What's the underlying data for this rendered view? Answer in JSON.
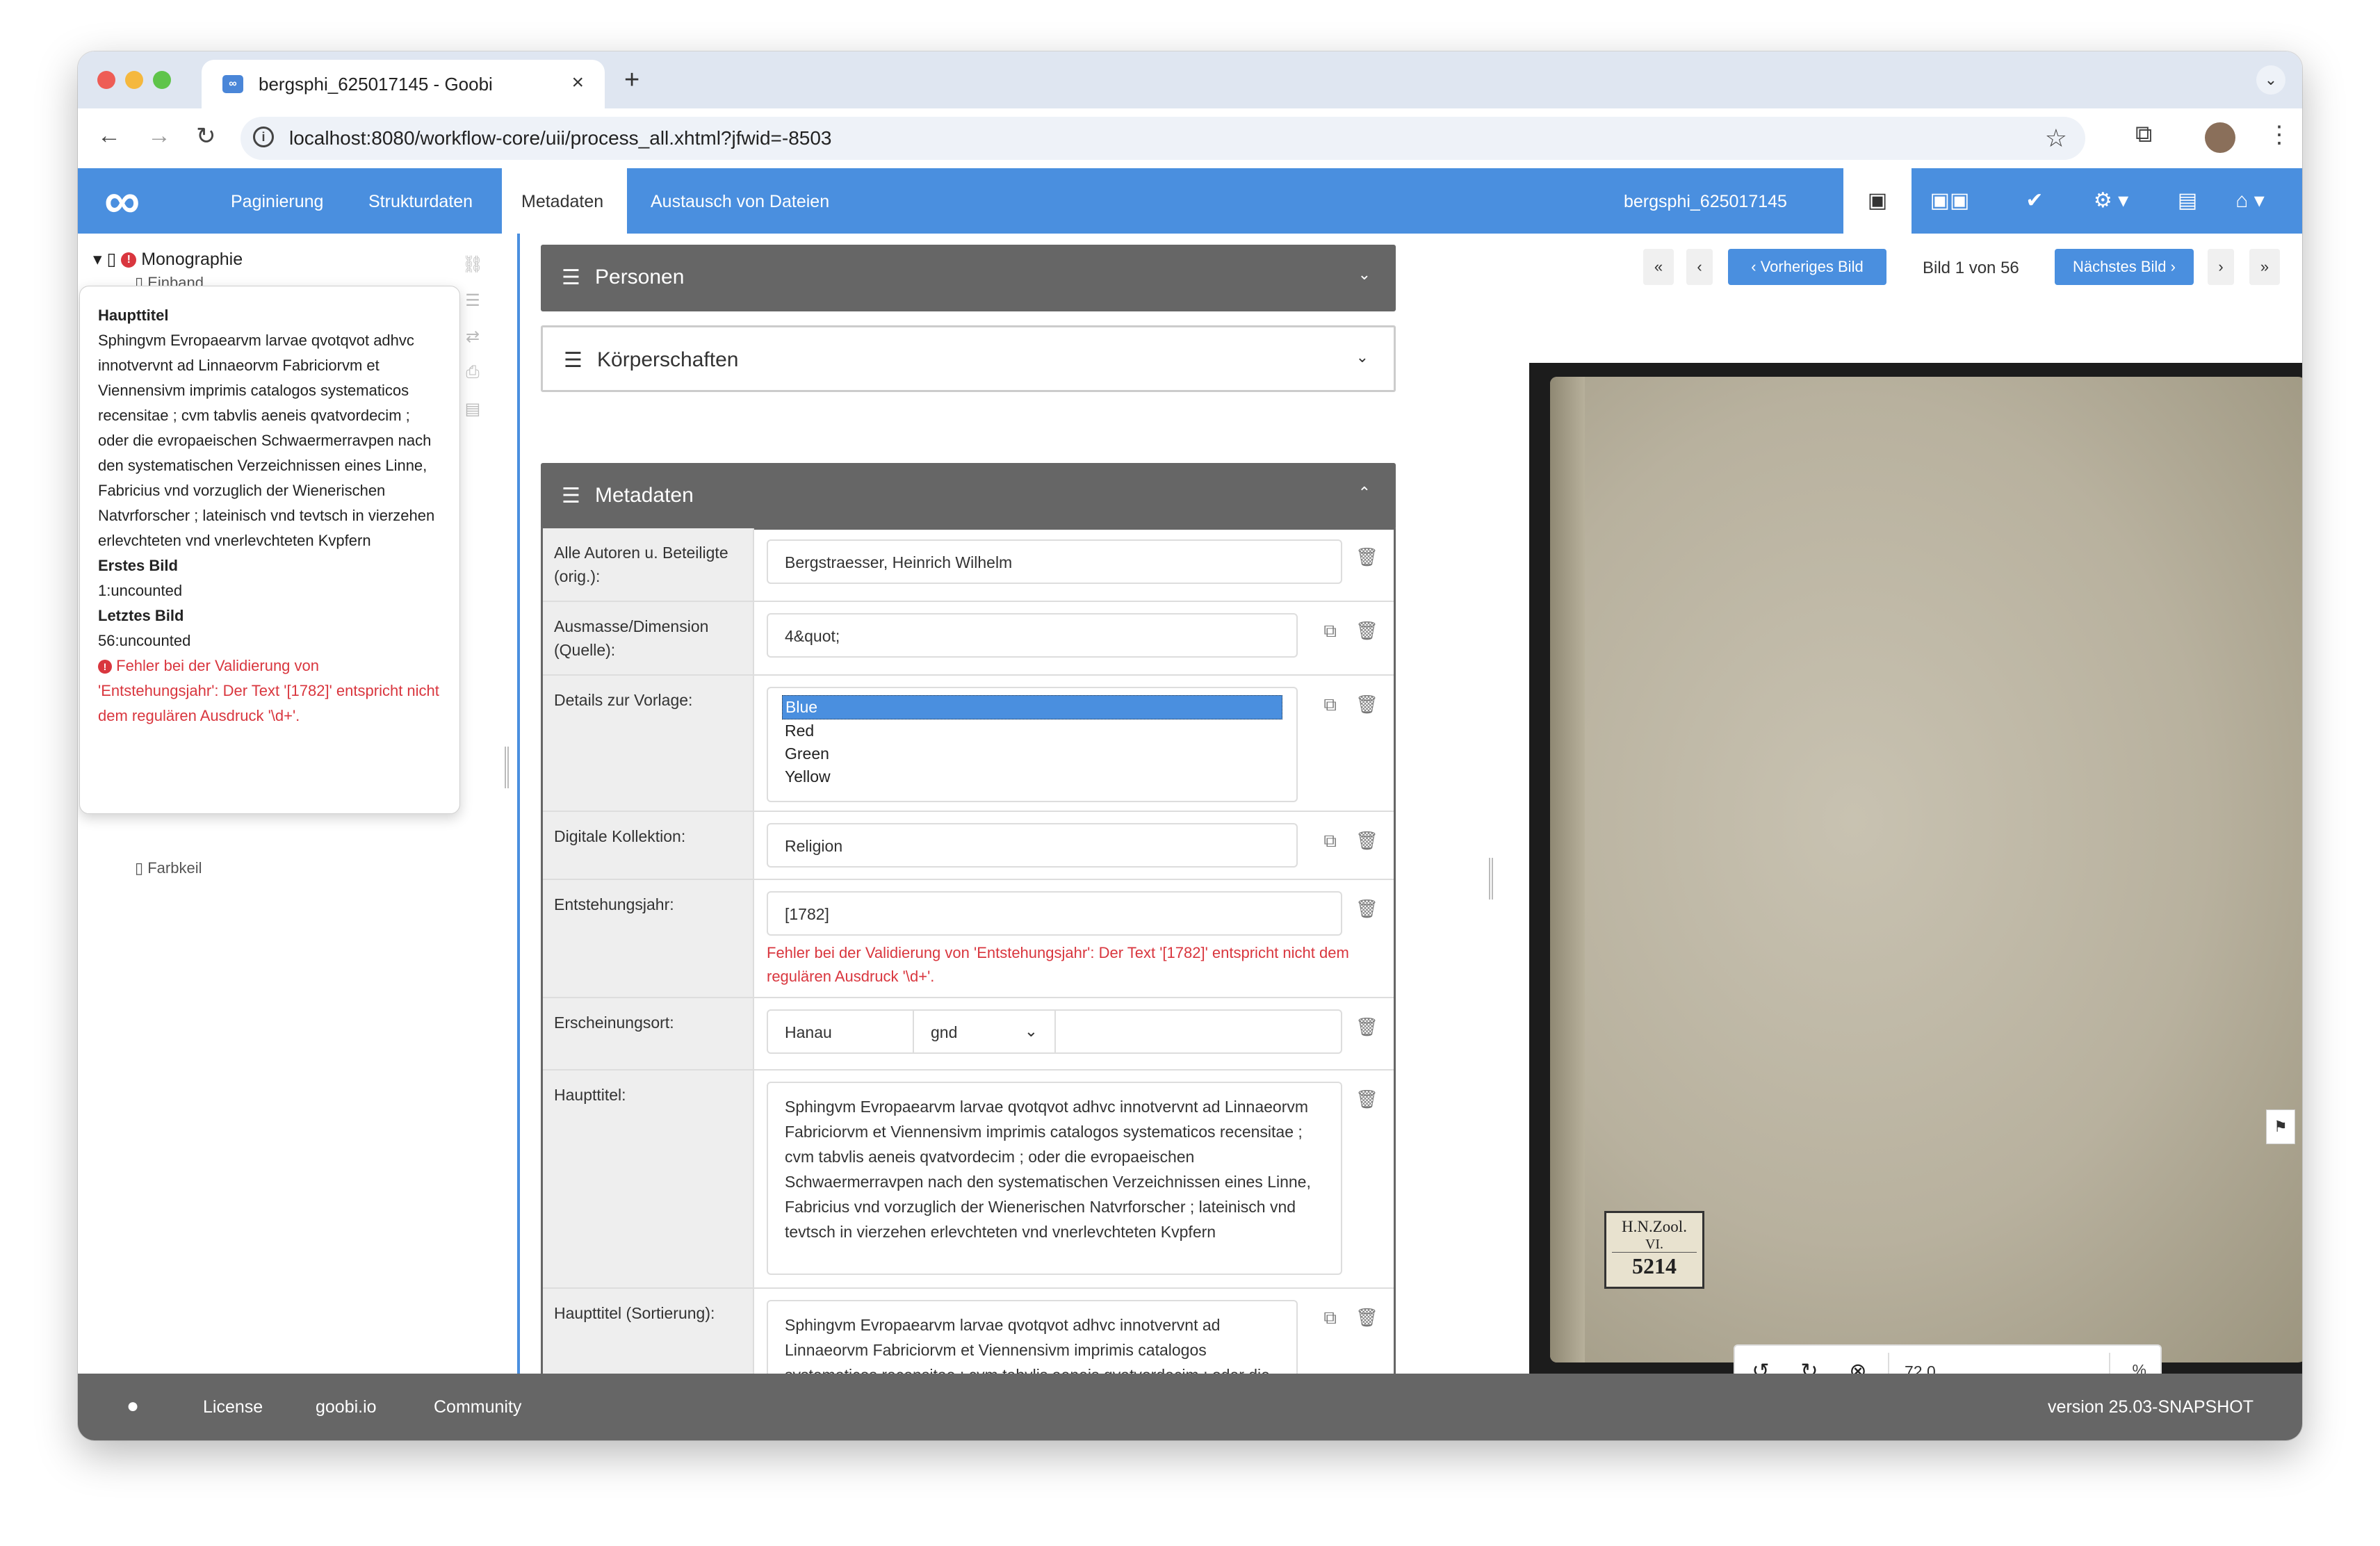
{
  "browser": {
    "tab_title": "bergsphi_625017145 - Goobi",
    "url": "localhost:8080/workflow-core/uii/process_all.xhtml?jfwid=-8503",
    "tab_close": "×",
    "new_tab": "+"
  },
  "nav": {
    "logo": "∞",
    "items": [
      "Paginierung",
      "Strukturdaten",
      "Metadaten",
      "Austausch von Dateien"
    ],
    "active": "Metadaten",
    "process_name": "bergsphi_625017145"
  },
  "tree": {
    "root": "Monographie",
    "child_partial": "Einband",
    "child_last": "Farbkeil"
  },
  "tooltip": {
    "haupttitel_label": "Haupttitel",
    "haupttitel_value": "Sphingvm Evropaearvm larvae qvotqvot adhvc innotvervnt ad Linnaeorvm Fabriciorvm et Viennensivm imprimis catalogos systematicos recensitae ; cvm tabvlis aeneis qvatvordecim ; oder die evropaeischen Schwaermerravpen nach den systematischen Verzeichnissen eines Linne, Fabricius vnd vorzuglich der Wienerischen Natvrforscher ; lateinisch vnd tevtsch in vierzehen erlevchteten vnd vnerlevchteten Kvpfern",
    "erstes_label": "Erstes Bild",
    "erstes_value": "1:uncounted",
    "letztes_label": "Letztes Bild",
    "letztes_value": "56:uncounted",
    "error": "Fehler bei der Validierung von 'Entstehungsjahr': Der Text '[1782]' entspricht nicht dem regulären Ausdruck '\\d+'."
  },
  "boxes": {
    "personen": "Personen",
    "koerperschaften": "Körperschaften",
    "metadaten": "Metadaten"
  },
  "metadata": {
    "autoren_label": "Alle Autoren u. Beteiligte (orig.):",
    "autoren_value": "Bergstraesser, Heinrich Wilhelm",
    "ausmasse_label": "Ausmasse/Dimension (Quelle):",
    "ausmasse_value": "4&quot;",
    "details_label": "Details zur Vorlage:",
    "details_options": [
      "Blue",
      "Red",
      "Green",
      "Yellow"
    ],
    "digital_label": "Digitale Kollektion:",
    "digital_value": "Religion",
    "jahr_label": "Entstehungsjahr:",
    "jahr_value": "[1782]",
    "jahr_error": "Fehler bei der Validierung von 'Entstehungsjahr': Der Text '[1782]' entspricht nicht dem regulären Ausdruck '\\d+'.",
    "ort_label": "Erscheinungsort:",
    "ort_value": "Hanau",
    "ort_authority": "gnd",
    "haupttitel_label": "Haupttitel:",
    "haupttitel_value": "Sphingvm Evropaearvm larvae qvotqvot adhvc innotvervnt ad Linnaeorvm Fabriciorvm et Viennensivm imprimis catalogos systematicos recensitae ; cvm tabvlis aeneis qvatvordecim ; oder die evropaeischen Schwaermerravpen nach den systematischen Verzeichnissen eines Linne, Fabricius vnd vorzuglich der Wienerischen Natvrforscher ; lateinisch vnd tevtsch in vierzehen erlevchteten vnd vnerlevchteten Kvpfern",
    "sortierung_label": "Haupttitel (Sortierung):",
    "sortierung_value": "Sphingvm Evropaearvm larvae qvotqvot adhvc innotvervnt ad Linnaeorvm Fabriciorvm et Viennensivm imprimis catalogos systematicos recensitae ; cvm tabvlis aeneis qvatvordecim ; oder die evropaeischen Schwaermerravpen nach den systematischen Verzeichnissen eines Linne, Fabricius vnd"
  },
  "viewer": {
    "first": "«",
    "prev": "‹",
    "prev_label": "‹ Vorheriges Bild",
    "page": "Bild 1 von 56",
    "next_label": "Nächstes Bild ›",
    "next": "›",
    "last": "»",
    "label_line1": "H.N.Zool.",
    "label_line2": "VI.",
    "label_line3": "5214",
    "zoom_value": "72.0",
    "zoom_unit": "%"
  },
  "footer": {
    "license": "License",
    "goobi": "goobi.io",
    "community": "Community",
    "version": "version 25.03-SNAPSHOT"
  },
  "colors": {
    "nav_blue": "#4a8fdf",
    "error_red": "#d9363e",
    "box_header": "#666666"
  }
}
